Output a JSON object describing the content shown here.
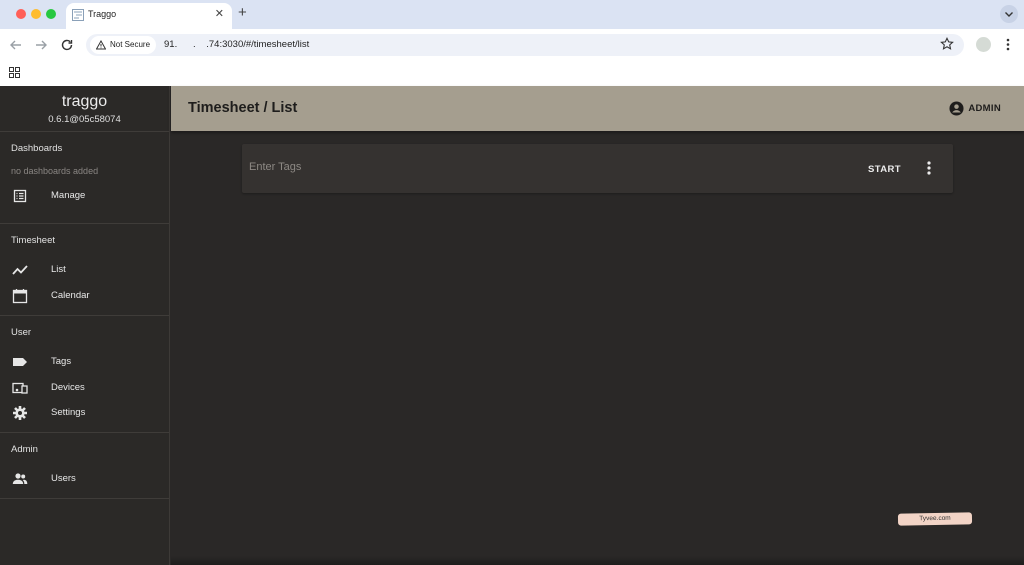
{
  "browser": {
    "tab_title": "Traggo",
    "security_label": "Not Secure",
    "url": "91.   .  .74:3030/#/timesheet/list"
  },
  "app": {
    "name": "traggo",
    "version": "0.6.1@05c58074",
    "page_title": "Timesheet / List",
    "user_label": "ADMIN"
  },
  "sidebar": {
    "dashboards": {
      "title": "Dashboards",
      "empty_note": "no dashboards added",
      "items": [
        {
          "label": "Manage",
          "icon": "list-alt-icon"
        }
      ]
    },
    "timesheet": {
      "title": "Timesheet",
      "items": [
        {
          "label": "List",
          "icon": "timeline-icon"
        },
        {
          "label": "Calendar",
          "icon": "calendar-icon"
        }
      ]
    },
    "user": {
      "title": "User",
      "items": [
        {
          "label": "Tags",
          "icon": "label-icon"
        },
        {
          "label": "Devices",
          "icon": "devices-icon"
        },
        {
          "label": "Settings",
          "icon": "gear-icon"
        }
      ]
    },
    "admin": {
      "title": "Admin",
      "items": [
        {
          "label": "Users",
          "icon": "people-icon"
        }
      ]
    }
  },
  "tracker": {
    "placeholder": "Enter Tags",
    "start_label": "START"
  },
  "watermark": "Tyvee.com",
  "colors": {
    "header": "#a59e8f",
    "background": "#2a2827",
    "sidebar": "#2b2927"
  }
}
